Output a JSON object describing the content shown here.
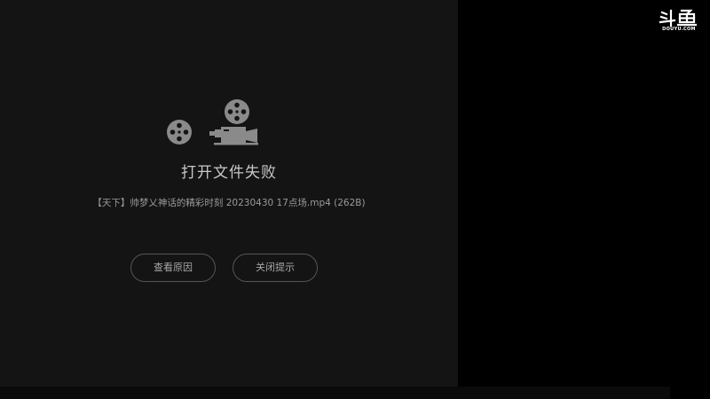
{
  "player": {
    "error_title": "打开文件失败",
    "file_name": "【天下】帅梦乂神话的精彩时刻 20230430 17点场.mp4 (262B)",
    "icon": "film-projector-icon",
    "buttons": {
      "view_reason": "查看原因",
      "close_tip": "关闭提示"
    }
  },
  "logo": {
    "wordmark": "斗鱼",
    "domain": "DOUYU.COM"
  },
  "colors": {
    "panel_background": "#141414",
    "outer_background": "#000000",
    "icon_gray": "#8a8a8a",
    "title_text": "#c8c8c8",
    "button_border": "#555555"
  }
}
